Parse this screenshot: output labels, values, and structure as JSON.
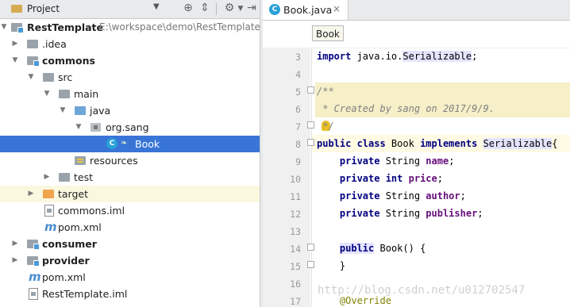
{
  "project_panel": {
    "title": "Project",
    "dropdown_arrow": "▼",
    "toolbar_icons": [
      "sync-icon",
      "collapse-all-icon",
      "gear-icon",
      "hide-icon"
    ]
  },
  "tree": [
    {
      "label": "RestTemplate",
      "path": "E:\\workspace\\demo\\RestTemplate",
      "icon": "module-folder",
      "arrow": "▼",
      "bold": true
    },
    {
      "label": ".idea",
      "icon": "folder",
      "arrow": "▶"
    },
    {
      "label": "commons",
      "icon": "module-folder",
      "arrow": "▼",
      "bold": true
    },
    {
      "label": "src",
      "icon": "folder",
      "arrow": "▼"
    },
    {
      "label": "main",
      "icon": "folder",
      "arrow": "▼"
    },
    {
      "label": "java",
      "icon": "source-folder",
      "arrow": "▼"
    },
    {
      "label": "org.sang",
      "icon": "package",
      "arrow": "▼"
    },
    {
      "label": "Book",
      "icon": "class",
      "class_letter": "C",
      "selected": true
    },
    {
      "label": "resources",
      "icon": "resources-folder"
    },
    {
      "label": "test",
      "icon": "folder",
      "arrow": "▶"
    },
    {
      "label": "target",
      "icon": "excluded-folder",
      "arrow": "▶",
      "excluded": true
    },
    {
      "label": "commons.iml",
      "icon": "iml-file"
    },
    {
      "label": "pom.xml",
      "icon": "maven-file",
      "maven_glyph": "m"
    },
    {
      "label": "consumer",
      "icon": "module-folder",
      "arrow": "▶",
      "bold": true
    },
    {
      "label": "provider",
      "icon": "module-folder",
      "arrow": "▶",
      "bold": true
    },
    {
      "label": "pom.xml",
      "icon": "maven-file",
      "maven_glyph": "m"
    },
    {
      "label": "RestTemplate.iml",
      "icon": "iml-file"
    }
  ],
  "editor": {
    "tab": {
      "label": "Book.java",
      "close": "×",
      "class_letter": "C"
    },
    "breadcrumb": "Book",
    "line_numbers": [
      "3",
      "4",
      "5",
      "6",
      "7",
      "8",
      "9",
      "10",
      "11",
      "12",
      "13",
      "14",
      "15",
      "16",
      "17"
    ],
    "watermark": "http://blog.csdn.net/u012702547"
  },
  "colors": {
    "selection": "#3875d7",
    "keyword": "#000080",
    "field": "#660e7a",
    "comment": "#808080",
    "annotation": "#808000",
    "doc_background": "#f6efc8"
  }
}
